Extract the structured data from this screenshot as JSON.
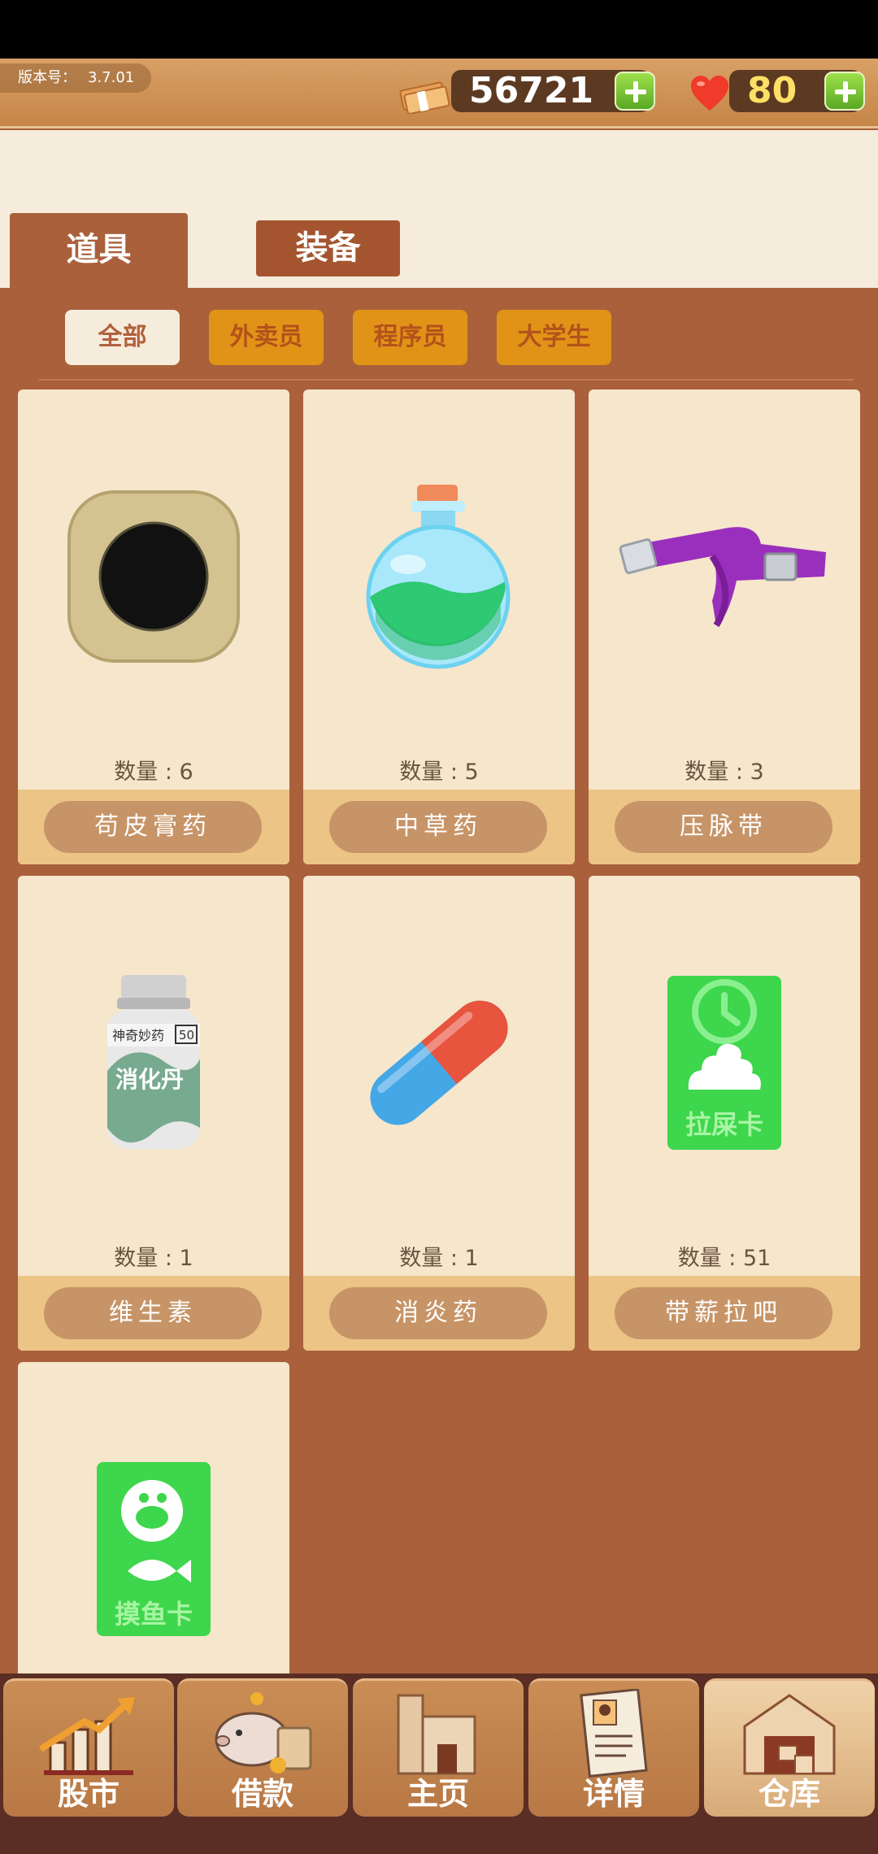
{
  "header": {
    "version_label": "版本号：",
    "version": "3.7.01",
    "money": "56721",
    "hearts": "80"
  },
  "tabs": [
    {
      "label": "道具",
      "active": true
    },
    {
      "label": "装备",
      "active": false
    }
  ],
  "filters": [
    {
      "label": "全部",
      "active": true
    },
    {
      "label": "外卖员",
      "active": false
    },
    {
      "label": "程序员",
      "active": false
    },
    {
      "label": "大学生",
      "active": false
    }
  ],
  "items": [
    {
      "qty": "数量 : 6",
      "name": "苟皮膏药",
      "icon": "plaster-icon"
    },
    {
      "qty": "数量 : 5",
      "name": "中草药",
      "icon": "potion-icon"
    },
    {
      "qty": "数量 : 3",
      "name": "压脉带",
      "icon": "tourniquet-icon"
    },
    {
      "qty": "数量 : 1",
      "name": "维生素",
      "icon": "pill-bottle-icon",
      "bottle_text": "消化丹",
      "bottle_small": "神奇妙药",
      "bottle_num": "50"
    },
    {
      "qty": "数量 : 1",
      "name": "消炎药",
      "icon": "capsule-icon"
    },
    {
      "qty": "数量 : 51",
      "name": "带薪拉吧",
      "icon": "poop-card-icon",
      "card_text": "拉屎卡"
    },
    {
      "qty": "",
      "name": "",
      "icon": "fish-card-icon",
      "card_text": "摸鱼卡"
    }
  ],
  "nav": [
    {
      "label": "股市",
      "icon": "stock-chart-icon"
    },
    {
      "label": "借款",
      "icon": "piggy-bank-icon"
    },
    {
      "label": "主页",
      "icon": "home-icon"
    },
    {
      "label": "详情",
      "icon": "profile-doc-icon"
    },
    {
      "label": "仓库",
      "icon": "warehouse-icon",
      "active": true
    }
  ],
  "colors": {
    "background": "#a9603b",
    "card": "#f6e6cc",
    "chip_inactive": "#e19318",
    "plus_green": "#5aa825"
  }
}
